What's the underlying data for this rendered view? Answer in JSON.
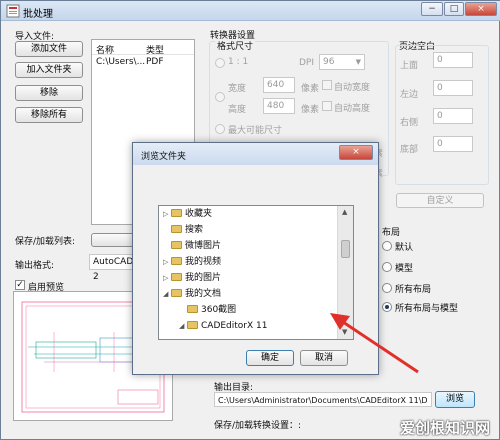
{
  "window": {
    "title": "批处理",
    "controls": [
      "−",
      "□",
      "×"
    ]
  },
  "import": {
    "label": "导入文件:",
    "buttons": [
      "添加文件",
      "加入文件夹",
      "移除",
      "移除所有"
    ],
    "columns": [
      "名称",
      "类型"
    ],
    "rows": [
      {
        "name": "C:\\Users\\...",
        "type": "PDF"
      }
    ]
  },
  "save_load_list_label": "保存/加载列表:",
  "output_format": {
    "label": "输出格式:",
    "value": "AutoCAD 2"
  },
  "enable_preview": {
    "label": "启用预览",
    "checked": true
  },
  "converter": {
    "title": "转换器设置",
    "format_size": "格式尺寸",
    "ratio_label": "1 : 1",
    "dpi_label": "DPI",
    "dpi_value": "96",
    "width_label": "宽度",
    "width_value": "640",
    "height_label": "高度",
    "height_value": "480",
    "unit": "像素",
    "auto_width": "自动宽度",
    "auto_height": "自动高度",
    "max_size": "最大可能尺寸",
    "unit2": "像素",
    "unit3": "像素"
  },
  "margins": {
    "title": "页边空白",
    "top_label": "上面",
    "top_value": "0",
    "left_label": "左边",
    "left_value": "0",
    "right_label": "右侧",
    "right_value": "0",
    "bottom_label": "底部",
    "bottom_value": "0",
    "custom_button": "自定义"
  },
  "layout": {
    "title": "布局",
    "options": [
      "默认",
      "模型",
      "所有布局",
      "所有布局与模型"
    ],
    "selected": "所有布局与模型"
  },
  "output_dir": {
    "label": "输出目录:",
    "value": "C:\\Users\\Administrator\\Documents\\CADEditorX 11\\D",
    "browse_button": "浏览"
  },
  "save_load_settings_label": "保存/加载转换设置：:",
  "dialog": {
    "title": "浏览文件夹",
    "close": "×",
    "tree": [
      {
        "label": "收藏夹",
        "indent": 0,
        "expander": "▷",
        "icon": "star-folder"
      },
      {
        "label": "搜索",
        "indent": 0,
        "expander": "",
        "icon": "search-folder"
      },
      {
        "label": "微博图片",
        "indent": 0,
        "expander": "",
        "icon": "folder"
      },
      {
        "label": "我的视频",
        "indent": 0,
        "expander": "▷",
        "icon": "video-folder"
      },
      {
        "label": "我的图片",
        "indent": 0,
        "expander": "▷",
        "icon": "picture-folder"
      },
      {
        "label": "我的文档",
        "indent": 0,
        "expander": "◢",
        "icon": "documents-folder"
      },
      {
        "label": "360截图",
        "indent": 1,
        "expander": "",
        "icon": "folder"
      },
      {
        "label": "CADEditorX 11",
        "indent": 1,
        "expander": "◢",
        "icon": "folder"
      }
    ],
    "ok_button": "确定",
    "cancel_button": "取消"
  },
  "watermark": "爱创根知识网"
}
